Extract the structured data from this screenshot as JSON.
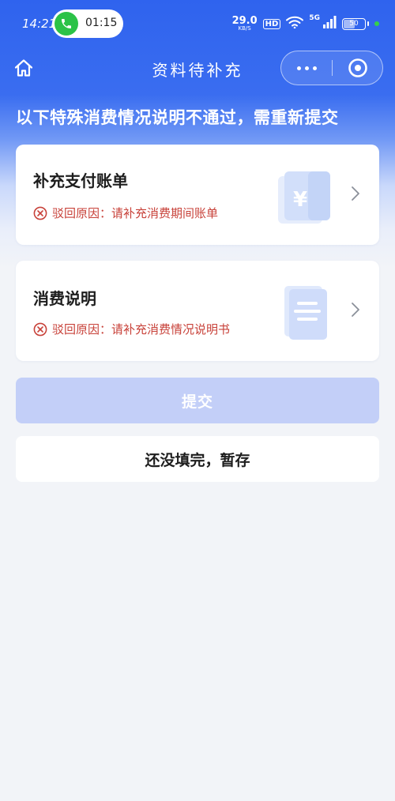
{
  "status_bar": {
    "time": "14:21",
    "call_duration": "01:15",
    "net_speed": "29.0",
    "net_speed_unit": "KB/S",
    "hd_label": "HD",
    "network_label": "5G",
    "battery": "50"
  },
  "nav": {
    "title": "资料待补充"
  },
  "notice": "以下特殊消费情况说明不通过，需重新提交",
  "cards": [
    {
      "title": "补充支付账单",
      "reject_reason": "驳回原因：请补充消费期间账单",
      "icon": "yuan-wallet-icon"
    },
    {
      "title": "消费说明",
      "reject_reason": "驳回原因：请补充消费情况说明书",
      "icon": "document-icon"
    }
  ],
  "buttons": {
    "submit": "提交",
    "save_draft": "还没填完，暂存"
  },
  "colors": {
    "brand_blue": "#3a6df0",
    "reject_red": "#c8423a",
    "submit_disabled": "#c3cff8",
    "call_green": "#2bc247"
  }
}
